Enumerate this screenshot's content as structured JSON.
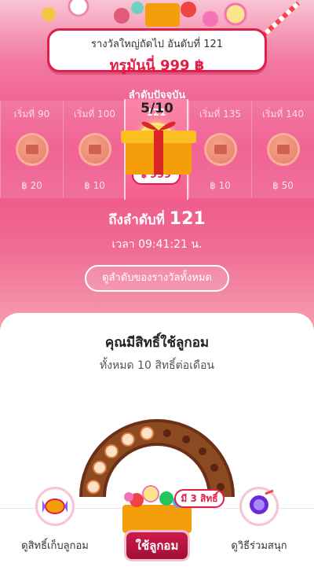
{
  "banner": {
    "subtitle": "รางวัลใหญ่ถัดไป อันดับที่ 121",
    "prize": "ทรูมันนี่ 999 ฿"
  },
  "ranking": {
    "section_title": "ลำดับปัจจุบัน",
    "columns": [
      {
        "label": "เริ่มที่ 90",
        "amount": "฿ 20",
        "current": false
      },
      {
        "label": "เริ่มที่ 100",
        "amount": "฿ 10",
        "current": false
      },
      {
        "label": "121",
        "amount": "999",
        "current": true
      },
      {
        "label": "เริ่มที่ 135",
        "amount": "฿ 10",
        "current": false
      },
      {
        "label": "เริ่มที่ 140",
        "amount": "฿ 50",
        "current": false
      }
    ],
    "currency_symbol": "฿"
  },
  "status": {
    "reach_text": "ถึงลำดับที่",
    "reach_number": "121",
    "time_text": "เวลา 09:41:21 น.",
    "view_all_label": "ดูลำดับของรางวัลทั้งหมด"
  },
  "card": {
    "title": "คุณมีสิทธิ์ใช้ลูกอม",
    "subtitle": "ทั้งหมด 10 สิทธิ์ต่อเดือน",
    "counter": "5/10",
    "used": 5,
    "total": 10
  },
  "bottom_nav": {
    "collect_label": "ดูสิทธิ์เก็บลูกอม",
    "play_label": "ใช้ลูกอม",
    "rights_badge": "มี 3 สิทธิ์",
    "howto_label": "ดูวิธีร่วมสนุก"
  },
  "colors": {
    "accent": "#e11d48",
    "pink_bg": "#ee4f86",
    "gold": "#f3c21a",
    "arc_brown": "#7a3a1c"
  },
  "icons": {
    "coin": "coin-icon",
    "candy": "candy-icon",
    "gift": "gift-icon",
    "lollipop": "lollipop-icon"
  }
}
